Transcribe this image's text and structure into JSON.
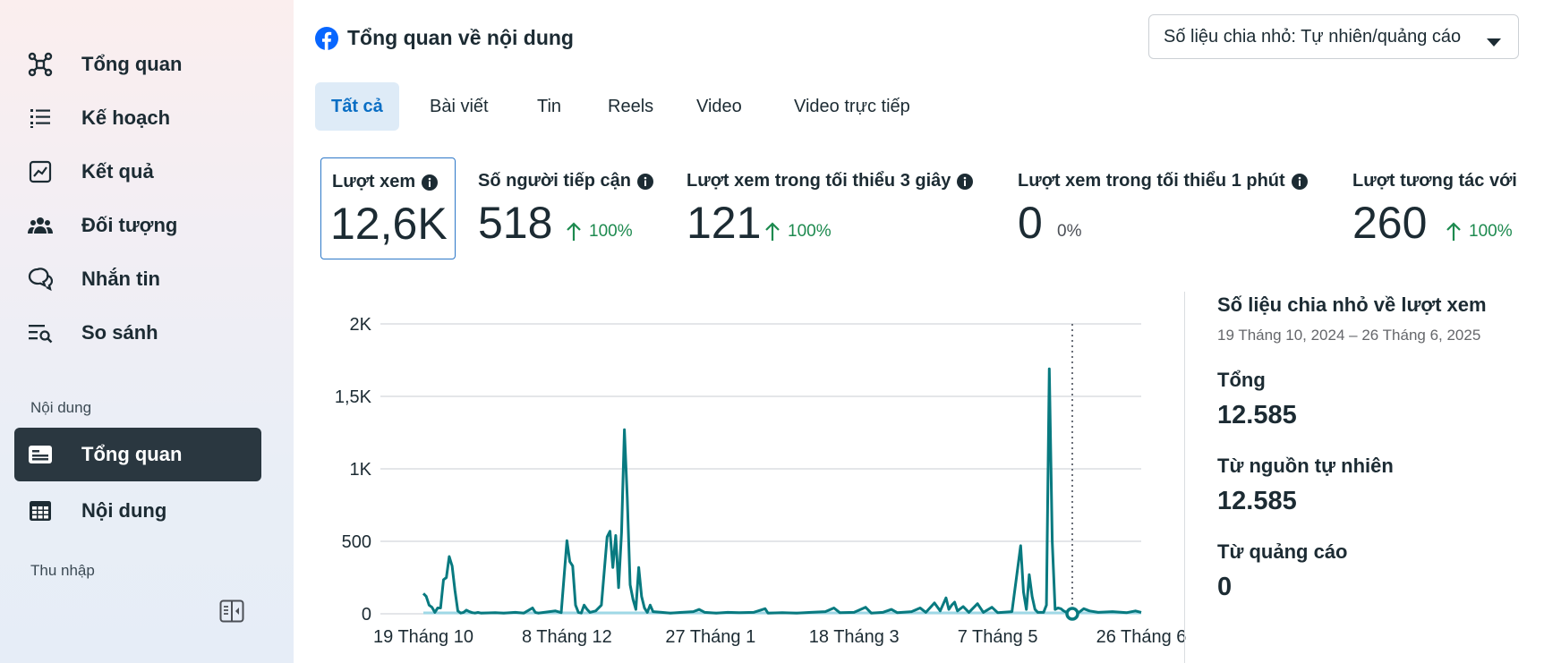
{
  "sidebar": {
    "items": [
      {
        "label": "Tổng quan",
        "icon": "network-nodes-icon"
      },
      {
        "label": "Kế hoạch",
        "icon": "list-icon"
      },
      {
        "label": "Kết quả",
        "icon": "line-chart-icon"
      },
      {
        "label": "Đối tượng",
        "icon": "people-group-icon"
      },
      {
        "label": "Nhắn tin",
        "icon": "chat-bubbles-icon"
      },
      {
        "label": "So sánh",
        "icon": "compare-search-icon"
      }
    ],
    "section_content": "Nội dung",
    "content_items": [
      {
        "label": "Tổng quan",
        "icon": "id-card-icon",
        "active": true
      },
      {
        "label": "Nội dung",
        "icon": "table-grid-icon"
      }
    ],
    "section_income": "Thu nhập"
  },
  "header": {
    "title": "Tổng quan về nội dung",
    "breakdown_dropdown": "Số liệu chia nhỏ: Tự nhiên/quảng cáo"
  },
  "tabs": [
    "Tất cả",
    "Bài viết",
    "Tin",
    "Reels",
    "Video",
    "Video trực tiếp"
  ],
  "metrics": [
    {
      "label": "Lượt xem",
      "value": "12,6K",
      "delta": ""
    },
    {
      "label": "Số người tiếp cận",
      "value": "518",
      "delta": "100%"
    },
    {
      "label": "Lượt xem trong tối thiểu 3 giây",
      "value": "121",
      "delta": "100%"
    },
    {
      "label": "Lượt xem trong tối thiểu 1 phút",
      "value": "0",
      "delta": "0%"
    },
    {
      "label": "Lượt tương tác với",
      "value": "260",
      "delta": "100%"
    }
  ],
  "breakdown_panel": {
    "title": "Số liệu chia nhỏ về lượt xem",
    "date_range": "19 Tháng 10, 2024 – 26 Tháng 6, 2025",
    "total_label": "Tổng",
    "total_value": "12.585",
    "organic_label": "Từ nguồn tự nhiên",
    "organic_value": "12.585",
    "ads_label": "Từ quảng cáo",
    "ads_value": "0"
  },
  "colors": {
    "accent": "#0a6ec4",
    "line": "#087a80",
    "positive": "#1d8a4f",
    "active_nav": "#2a3740"
  },
  "chart_data": {
    "type": "line",
    "ylim": [
      0,
      2000
    ],
    "y_ticks": [
      0,
      500,
      1000,
      1500,
      2000
    ],
    "y_tick_labels": [
      "0",
      "500",
      "1K",
      "1,5K",
      "2K"
    ],
    "x_tick_labels": [
      "19 Tháng 10",
      "8 Tháng 12",
      "27 Tháng 1",
      "18 Tháng 3",
      "7 Tháng 5",
      "26 Tháng 6"
    ],
    "x_start": "2024-10-19",
    "x_end": "2025-06-26",
    "grid": true,
    "series": [
      {
        "values": [
          [
            0,
            140
          ],
          [
            1,
            120
          ],
          [
            2,
            60
          ],
          [
            3,
            45
          ],
          [
            4,
            10
          ],
          [
            5,
            40
          ],
          [
            6,
            40
          ],
          [
            7,
            235
          ],
          [
            8,
            250
          ],
          [
            9,
            395
          ],
          [
            10,
            330
          ],
          [
            11,
            160
          ],
          [
            12,
            20
          ],
          [
            13,
            5
          ],
          [
            14,
            10
          ],
          [
            15,
            25
          ],
          [
            16,
            15
          ],
          [
            17,
            8
          ],
          [
            18,
            5
          ],
          [
            19,
            10
          ],
          [
            20,
            5
          ],
          [
            25,
            8
          ],
          [
            28,
            5
          ],
          [
            32,
            10
          ],
          [
            35,
            5
          ],
          [
            38,
            40
          ],
          [
            39,
            10
          ],
          [
            40,
            5
          ],
          [
            46,
            20
          ],
          [
            48,
            8
          ],
          [
            50,
            505
          ],
          [
            51,
            360
          ],
          [
            52,
            330
          ],
          [
            53,
            60
          ],
          [
            54,
            10
          ],
          [
            55,
            5
          ],
          [
            56,
            60
          ],
          [
            57,
            30
          ],
          [
            58,
            10
          ],
          [
            60,
            20
          ],
          [
            62,
            60
          ],
          [
            64,
            530
          ],
          [
            65,
            570
          ],
          [
            66,
            320
          ],
          [
            67,
            540
          ],
          [
            68,
            180
          ],
          [
            69,
            560
          ],
          [
            70,
            1270
          ],
          [
            71,
            800
          ],
          [
            72,
            200
          ],
          [
            73,
            100
          ],
          [
            74,
            30
          ],
          [
            75,
            320
          ],
          [
            76,
            120
          ],
          [
            77,
            40
          ],
          [
            78,
            10
          ],
          [
            79,
            60
          ],
          [
            80,
            15
          ],
          [
            83,
            10
          ],
          [
            86,
            5
          ],
          [
            90,
            10
          ],
          [
            94,
            15
          ],
          [
            96,
            30
          ],
          [
            98,
            10
          ],
          [
            102,
            5
          ],
          [
            106,
            10
          ],
          [
            110,
            8
          ],
          [
            115,
            10
          ],
          [
            119,
            35
          ],
          [
            120,
            5
          ],
          [
            125,
            8
          ],
          [
            130,
            5
          ],
          [
            135,
            10
          ],
          [
            140,
            15
          ],
          [
            143,
            40
          ],
          [
            145,
            8
          ],
          [
            150,
            10
          ],
          [
            154,
            45
          ],
          [
            156,
            5
          ],
          [
            160,
            10
          ],
          [
            163,
            30
          ],
          [
            165,
            8
          ],
          [
            170,
            15
          ],
          [
            173,
            40
          ],
          [
            175,
            10
          ],
          [
            178,
            75
          ],
          [
            180,
            20
          ],
          [
            182,
            110
          ],
          [
            183,
            30
          ],
          [
            184,
            60
          ],
          [
            185,
            80
          ],
          [
            186,
            20
          ],
          [
            188,
            50
          ],
          [
            190,
            10
          ],
          [
            193,
            70
          ],
          [
            195,
            10
          ],
          [
            198,
            45
          ],
          [
            200,
            8
          ],
          [
            205,
            15
          ],
          [
            208,
            470
          ],
          [
            209,
            150
          ],
          [
            210,
            30
          ],
          [
            211,
            270
          ],
          [
            212,
            120
          ],
          [
            213,
            30
          ],
          [
            214,
            10
          ],
          [
            216,
            10
          ],
          [
            217,
            60
          ],
          [
            218,
            1690
          ],
          [
            219,
            500
          ],
          [
            220,
            30
          ],
          [
            221,
            40
          ],
          [
            222,
            35
          ],
          [
            223,
            20
          ],
          [
            224,
            10
          ],
          [
            225,
            30
          ],
          [
            226,
            8
          ],
          [
            228,
            5
          ],
          [
            230,
            35
          ],
          [
            232,
            20
          ],
          [
            235,
            10
          ],
          [
            240,
            15
          ],
          [
            245,
            8
          ],
          [
            248,
            20
          ],
          [
            250,
            10
          ]
        ],
        "color": "#087a80"
      },
      {
        "values": [
          [
            0,
            0
          ],
          [
            250,
            0
          ]
        ],
        "color": "#9fd8e6"
      }
    ],
    "hover_marker_day": 226
  }
}
